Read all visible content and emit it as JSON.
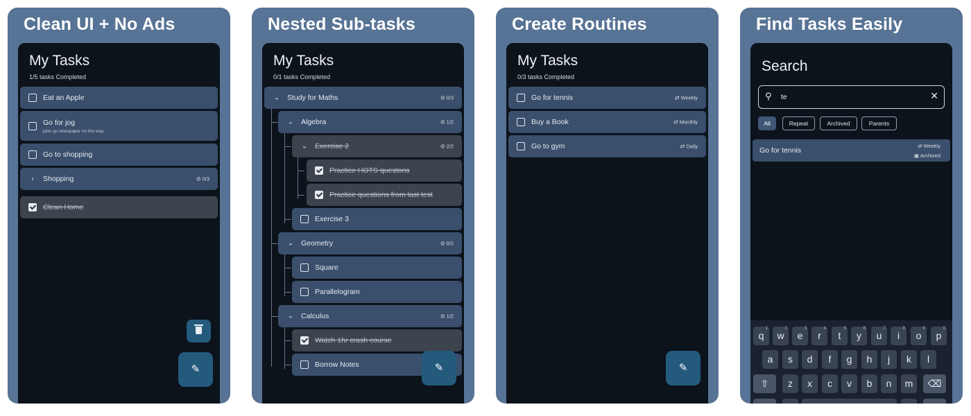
{
  "colors": {
    "card_bg": "#577395",
    "screen_bg": "#0c131b",
    "task_bg": "#3a4f6c",
    "task_done_bg": "#3d444e",
    "fab_bg": "#245a7c"
  },
  "icons": {
    "checkbox": "checkbox-icon",
    "checked": "checkbox-checked-icon",
    "chevron_right": "chevron-right-icon",
    "chevron_down": "chevron-down-icon",
    "subtask_count": "circle-check-icon",
    "repeat": "repeat-icon",
    "archive": "archive-icon",
    "edit": "pencil-icon",
    "delete": "trash-icon",
    "search": "search-icon",
    "clear": "close-icon",
    "shift": "shift-icon",
    "backspace": "backspace-icon"
  },
  "panels": [
    {
      "heading": "Clean UI + No Ads",
      "title": "My Tasks",
      "subtitle": "1/5 tasks Completed",
      "tasks": [
        {
          "label": "Eat an Apple",
          "done": false
        },
        {
          "label": "Go for jog",
          "note": "pick up newspaper on the way",
          "done": false
        },
        {
          "label": "Go to shopping",
          "done": false
        },
        {
          "label": "Shopping",
          "count": "0/3",
          "expandable": true
        },
        {
          "label": "Clean Home",
          "done": true
        }
      ]
    },
    {
      "heading": "Nested Sub-tasks",
      "title": "My Tasks",
      "subtitle": "0/1 tasks Completed",
      "tasks": [
        {
          "label": "Study for Maths",
          "count": "0/3"
        },
        {
          "label": "Algebra",
          "count": "1/2"
        },
        {
          "label": "Exercise 2",
          "count": "2/2",
          "done": true
        },
        {
          "label": "Practice HOTS questons",
          "done": true
        },
        {
          "label": "Practice questions from last test",
          "done": true
        },
        {
          "label": "Exercise 3",
          "done": false
        },
        {
          "label": "Geometry",
          "count": "0/2"
        },
        {
          "label": "Square",
          "done": false
        },
        {
          "label": "Parallelogram",
          "done": false
        },
        {
          "label": "Calculus",
          "count": "1/2"
        },
        {
          "label": "Watch 1hr crash course",
          "done": true
        },
        {
          "label": "Borrow Notes",
          "done": false
        }
      ]
    },
    {
      "heading": "Create Routines",
      "title": "My Tasks",
      "subtitle": "0/3 tasks Completed",
      "tasks": [
        {
          "label": "Go for tennis",
          "repeat": "Weekly"
        },
        {
          "label": "Buy a Book",
          "repeat": "Monthly"
        },
        {
          "label": "Go to gym",
          "repeat": "Daily"
        }
      ]
    },
    {
      "heading": "Find Tasks Easily",
      "title": "Search",
      "query": "te",
      "filters": [
        "All",
        "Repeat",
        "Archived",
        "Parents"
      ],
      "result": {
        "label": "Go for tennis",
        "repeat": "Weekly",
        "archived": "Archived"
      },
      "keyboard": {
        "row1": [
          "q",
          "w",
          "e",
          "r",
          "t",
          "y",
          "u",
          "i",
          "o",
          "p"
        ],
        "row1_hints": [
          "1",
          "2",
          "3",
          "4",
          "5",
          "6",
          "7",
          "8",
          "9",
          "0"
        ],
        "row2": [
          "a",
          "s",
          "d",
          "f",
          "g",
          "h",
          "j",
          "k",
          "l"
        ],
        "row3": [
          "z",
          "x",
          "c",
          "v",
          "b",
          "n",
          "m"
        ]
      }
    }
  ]
}
